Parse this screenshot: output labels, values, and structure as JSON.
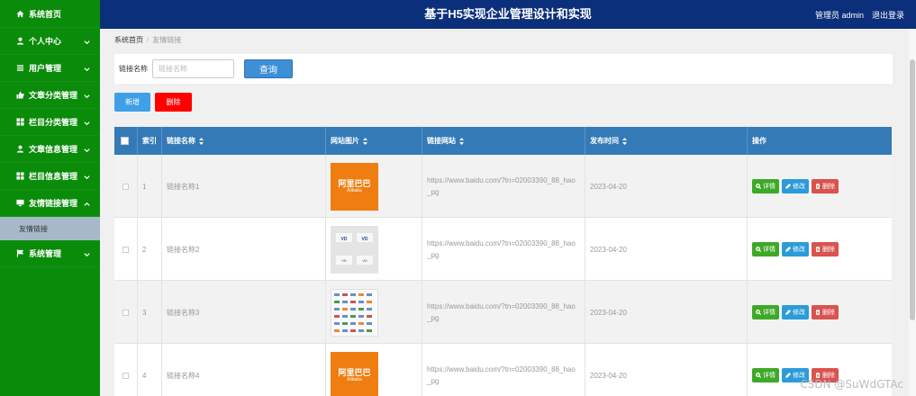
{
  "header": {
    "title": "基于H5实现企业管理设计和实现",
    "admin_label": "管理员 admin",
    "logout_label": "退出登录"
  },
  "sidebar": {
    "items": [
      {
        "label": "系统首页",
        "icon": "home-icon"
      },
      {
        "label": "个人中心",
        "icon": "user-icon"
      },
      {
        "label": "用户管理",
        "icon": "list-icon"
      },
      {
        "label": "文章分类管理",
        "icon": "thumbs-up-icon"
      },
      {
        "label": "栏目分类管理",
        "icon": "grid-icon"
      },
      {
        "label": "文章信息管理",
        "icon": "user-icon"
      },
      {
        "label": "栏目信息管理",
        "icon": "grid-icon"
      },
      {
        "label": "友情链接管理",
        "icon": "monitor-icon"
      },
      {
        "label": "系统管理",
        "icon": "flag-icon"
      }
    ],
    "sub_item": "友情链接"
  },
  "breadcrumb": {
    "home": "系统首页",
    "separator": "/",
    "current": "友情链接"
  },
  "search": {
    "label": "链接名称",
    "placeholder": "链接名称",
    "button": "查询"
  },
  "actions": {
    "add": "新增",
    "delete": "删除"
  },
  "table": {
    "headers": {
      "index": "索引",
      "name": "链接名称",
      "image": "网站图片",
      "url": "链接网站",
      "date": "发布时间",
      "ops": "操作"
    },
    "rows": [
      {
        "index": "1",
        "name": "链接名称1",
        "url": "https://www.baidu.com/?tn=02003390_88_hao_pg",
        "date": "2023-04-20",
        "thumb_logo": "阿里巴巴",
        "thumb_sub": "Alibaba"
      },
      {
        "index": "2",
        "name": "链接名称2",
        "url": "https://www.baidu.com/?tn=02003390_88_hao_pg",
        "date": "2023-04-20"
      },
      {
        "index": "3",
        "name": "链接名称3",
        "url": "https://www.baidu.com/?tn=02003390_88_hao_pg",
        "date": "2023-04-20"
      },
      {
        "index": "4",
        "name": "链接名称4",
        "url": "https://www.baidu.com/?tn=02003390_88_hao_pg",
        "date": "2023-04-20",
        "thumb_logo": "阿里巴巴",
        "thumb_sub": "Alibaba"
      }
    ],
    "op_labels": {
      "detail": "详情",
      "edit": "修改",
      "remove": "删除"
    }
  },
  "watermark": "CSDN @SuWdGTAc",
  "colors": {
    "sidebar": "#0a8c0a",
    "header": "#0b2f7a",
    "table_header": "#337ab7",
    "detail_btn": "#3da928",
    "edit_btn": "#2c9bd9",
    "remove_btn": "#d9534f",
    "delete_btn": "#ff0000"
  }
}
